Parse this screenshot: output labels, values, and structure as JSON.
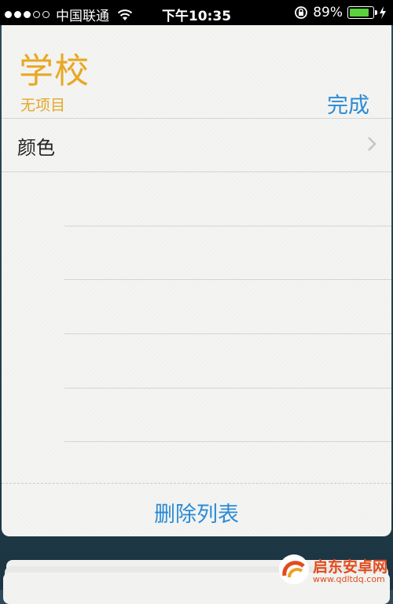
{
  "status_bar": {
    "carrier": "中国联通",
    "time": "下午10:35",
    "battery_percent": "89%",
    "battery_level": 0.89,
    "signal_bars_filled": 3,
    "signal_bars_total": 5
  },
  "list": {
    "title": "学校",
    "subtitle": "无项目",
    "done_label": "完成",
    "rows": [
      {
        "label": "颜色"
      }
    ],
    "delete_label": "删除列表"
  },
  "watermark": {
    "name": "启东安卓网",
    "url": "www.qdltdq.com"
  },
  "colors": {
    "title": "#e8a823",
    "accent": "#2a8bd6",
    "battery": "#5ad23c"
  }
}
